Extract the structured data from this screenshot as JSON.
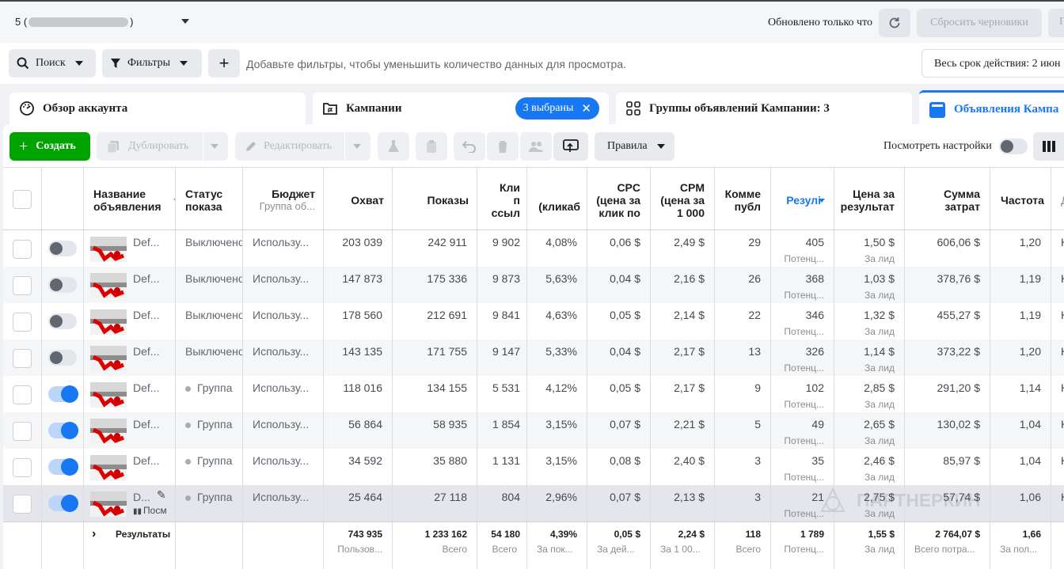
{
  "header": {
    "account_prefix": "5 (",
    "account_suffix": ")",
    "updated_text": "Обновлено только что",
    "reset_drafts_label": "Сбросить черновики",
    "extra_button_label": "П"
  },
  "filter_bar": {
    "search_label": "Поиск",
    "filters_label": "Фильтры",
    "add_label": "+",
    "hint": "Добавьте фильтры, чтобы уменьшить количество данных для просмотра.",
    "period_label": "Весь срок действия: 2 июн"
  },
  "tabs": {
    "overview": "Обзор аккаунта",
    "campaigns": "Кампании",
    "campaigns_badge": "3 выбраны",
    "adsets": "Группы объявлений Кампании: 3",
    "ads": "Объявления Кампа"
  },
  "toolbar": {
    "create": "Создать",
    "duplicate": "Дублировать",
    "edit": "Редактировать",
    "rules": "Правила",
    "view_settings": "Посмотреть настройки"
  },
  "columns": {
    "name": [
      "Название",
      "объявления"
    ],
    "status": [
      "Статус",
      "показа"
    ],
    "budget": [
      "Бюджет",
      "Группа об..."
    ],
    "reach": "Охват",
    "impressions": "Показы",
    "clicks": [
      "Кли",
      "п",
      "ссыл"
    ],
    "ctr": "(кликаб",
    "cpc": [
      "CPC",
      "(цена за",
      "клик по"
    ],
    "cpm": [
      "CPM",
      "(цена за",
      "1 000"
    ],
    "comments": [
      "Комме",
      "публ"
    ],
    "results": "Резулі",
    "cost_per_result": [
      "Цена за",
      "результат"
    ],
    "spend": [
      "Сумма",
      "затрат"
    ],
    "frequency": "Частота",
    "last": [
      "",
      "Д"
    ]
  },
  "rows": [
    {
      "name": "Def...",
      "status": "Выключено",
      "active": false,
      "budget": "Использу...",
      "reach": "203 039",
      "impressions": "242 911",
      "clicks": "9 902",
      "ctr": "4,08%",
      "cpc": "0,06 $",
      "cpm": "2,49 $",
      "comments": "29",
      "results": "405",
      "results_sub": "Потенц...",
      "cpr": "1,50 $",
      "cpr_sub": "За лид",
      "spend": "606,06 $",
      "freq": "1,20",
      "last": "Н"
    },
    {
      "name": "Def...",
      "status": "Выключено",
      "active": false,
      "budget": "Использу...",
      "reach": "147 873",
      "impressions": "175 336",
      "clicks": "9 873",
      "ctr": "5,63%",
      "cpc": "0,04 $",
      "cpm": "2,16 $",
      "comments": "26",
      "results": "368",
      "results_sub": "Потенц...",
      "cpr": "1,03 $",
      "cpr_sub": "За лид",
      "spend": "378,76 $",
      "freq": "1,19",
      "last": "Н"
    },
    {
      "name": "Def...",
      "status": "Выключено",
      "active": false,
      "budget": "Использу...",
      "reach": "178 560",
      "impressions": "212 691",
      "clicks": "9 841",
      "ctr": "4,63%",
      "cpc": "0,05 $",
      "cpm": "2,14 $",
      "comments": "22",
      "results": "346",
      "results_sub": "Потенц...",
      "cpr": "1,32 $",
      "cpr_sub": "За лид",
      "spend": "455,27 $",
      "freq": "1,19",
      "last": "Н"
    },
    {
      "name": "Def...",
      "status": "Выключено",
      "active": false,
      "budget": "Использу...",
      "reach": "143 135",
      "impressions": "171 755",
      "clicks": "9 147",
      "ctr": "5,33%",
      "cpc": "0,04 $",
      "cpm": "2,17 $",
      "comments": "13",
      "results": "326",
      "results_sub": "Потенц...",
      "cpr": "1,14 $",
      "cpr_sub": "За лид",
      "spend": "373,22 $",
      "freq": "1,20",
      "last": "Н"
    },
    {
      "name": "Def...",
      "status": "Группа",
      "active": true,
      "budget": "Использу...",
      "reach": "118 016",
      "impressions": "134 155",
      "clicks": "5 531",
      "ctr": "4,12%",
      "cpc": "0,05 $",
      "cpm": "2,17 $",
      "comments": "9",
      "results": "102",
      "results_sub": "Потенц...",
      "cpr": "2,85 $",
      "cpr_sub": "За лид",
      "spend": "291,20 $",
      "freq": "1,14",
      "last": "Н"
    },
    {
      "name": "Def...",
      "status": "Группа",
      "active": true,
      "budget": "Использу...",
      "reach": "56 864",
      "impressions": "58 935",
      "clicks": "1 854",
      "ctr": "3,15%",
      "cpc": "0,07 $",
      "cpm": "2,21 $",
      "comments": "5",
      "results": "49",
      "results_sub": "Потенц...",
      "cpr": "2,65 $",
      "cpr_sub": "За лид",
      "spend": "130,02 $",
      "freq": "1,04",
      "last": "Н"
    },
    {
      "name": "Def...",
      "status": "Группа",
      "active": true,
      "budget": "Использу...",
      "reach": "34 592",
      "impressions": "35 880",
      "clicks": "1 131",
      "ctr": "3,15%",
      "cpc": "0,08 $",
      "cpm": "2,40 $",
      "comments": "3",
      "results": "35",
      "results_sub": "Потенц...",
      "cpr": "2,46 $",
      "cpr_sub": "За лид",
      "spend": "85,97 $",
      "freq": "1,04",
      "last": "Н"
    },
    {
      "name": "D...",
      "status": "Группа",
      "active": true,
      "budget": "Использу...",
      "reach": "25 464",
      "impressions": "27 118",
      "clicks": "804",
      "ctr": "2,96%",
      "cpc": "0,07 $",
      "cpm": "2,13 $",
      "comments": "3",
      "results": "21",
      "results_sub": "Потенц...",
      "cpr": "2,75 $",
      "cpr_sub": "За лид",
      "spend": "57,74 $",
      "freq": "1,06",
      "last": "Н",
      "hover_link": "Посм"
    }
  ],
  "totals": {
    "label": "Результаты",
    "reach": "743 935",
    "reach_sub": "Пользов...",
    "impressions": "1 233 162",
    "impressions_sub": "Всего",
    "clicks": "54 180",
    "clicks_sub": "Всего",
    "ctr": "4,39%",
    "ctr_sub": "За пок...",
    "cpc": "0,05 $",
    "cpc_sub": "За дей...",
    "cpm": "2,24 $",
    "cpm_sub": "За 1 00...",
    "comments": "118",
    "comments_sub": "Всего",
    "results": "1 789",
    "results_sub": "Потенц...",
    "cpr": "1,55 $",
    "cpr_sub": "За лид",
    "spend": "2 764,07 $",
    "spend_sub": "Всего потра...",
    "freq": "1,66",
    "freq_sub": "За пол..."
  },
  "watermark": "ПАРТНЕРКИН",
  "colors": {
    "accent": "#1877f2",
    "create": "#00a400",
    "hover_row": "#e4e6eb",
    "stripe": "#f5f6f7"
  }
}
